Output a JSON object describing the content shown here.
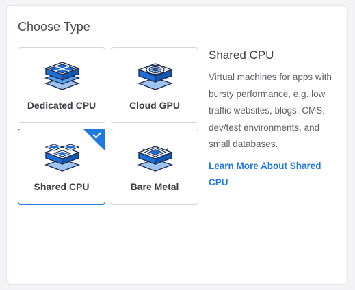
{
  "panel": {
    "title": "Choose Type"
  },
  "types": [
    {
      "label": "Dedicated CPU",
      "icon": "dedicated-cpu-icon",
      "selected": false
    },
    {
      "label": "Cloud GPU",
      "icon": "cloud-gpu-icon",
      "selected": false
    },
    {
      "label": "Shared CPU",
      "icon": "shared-cpu-icon",
      "selected": true
    },
    {
      "label": "Bare Metal",
      "icon": "bare-metal-icon",
      "selected": false
    }
  ],
  "description": {
    "title": "Shared CPU",
    "body": "Virtual machines for apps with bursty performance, e.g. low traffic websites, blogs, CMS, dev/test environments, and small databases.",
    "link": "Learn More About Shared CPU"
  },
  "colors": {
    "accent": "#1f7ae0",
    "icon_dark": "#1c6fd6",
    "icon_light": "#9fc4f2",
    "icon_navy": "#1d2b4f"
  }
}
